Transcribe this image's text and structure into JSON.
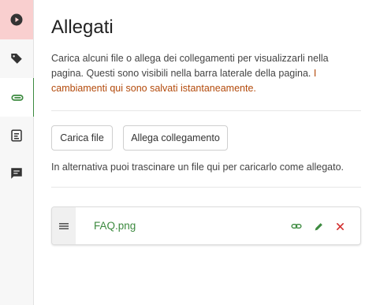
{
  "sidebar": {
    "items": [
      {
        "name": "play",
        "active": false
      },
      {
        "name": "tag",
        "active": false
      },
      {
        "name": "attachments",
        "active": true
      },
      {
        "name": "form",
        "active": false
      },
      {
        "name": "comments",
        "active": false
      }
    ]
  },
  "panel": {
    "title": "Allegati",
    "description": "Carica alcuni file o allega dei collegamenti per visualizzarli nella pagina. Questi sono visibili nella barra laterale della pagina. ",
    "description_warning": "I cambiamenti qui sono salvati istantaneamente.",
    "upload_button": "Carica file",
    "link_button": "Allega collegamento",
    "drag_hint": "In alternativa puoi trascinare un file qui per caricarlo come allegato."
  },
  "attachments": [
    {
      "filename": "FAQ.png"
    }
  ],
  "colors": {
    "accent_green": "#3c8a3f",
    "warning_orange": "#b34a0b",
    "danger_red": "#d32f2f",
    "active_tab_pink": "#f9cfcf"
  }
}
